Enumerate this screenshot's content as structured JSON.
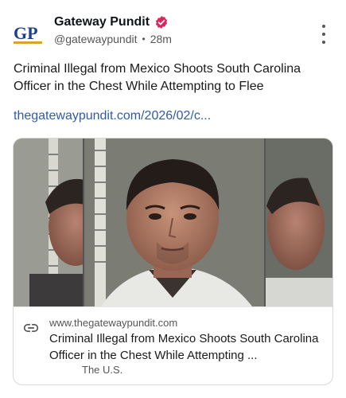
{
  "author": {
    "avatar_text": "GP",
    "display_name": "Gateway Pundit",
    "handle": "@gatewaypundit",
    "separator": "•",
    "time": "28m",
    "verified": true
  },
  "post": {
    "text": "Criminal Illegal from Mexico Shoots South Carolina Officer in the Chest While Attempting to Flee",
    "link_text": "thegatewaypundit.com/2026/02/c..."
  },
  "link_card": {
    "domain": "www.thegatewaypundit.com",
    "title": "Criminal Illegal from Mexico Shoots South Carolina Officer in the Chest While Attempting ...",
    "source": "The U.S.",
    "image_subject": "mugshot-photo"
  },
  "icons": {
    "more": "more-vertical-icon",
    "verified": "verified-badge-icon",
    "link": "link-icon"
  },
  "colors": {
    "link": "#2f5ba8",
    "verified": "#e0245e",
    "brand_blue": "#1d3f8f",
    "brand_gold": "#d9a42a"
  }
}
